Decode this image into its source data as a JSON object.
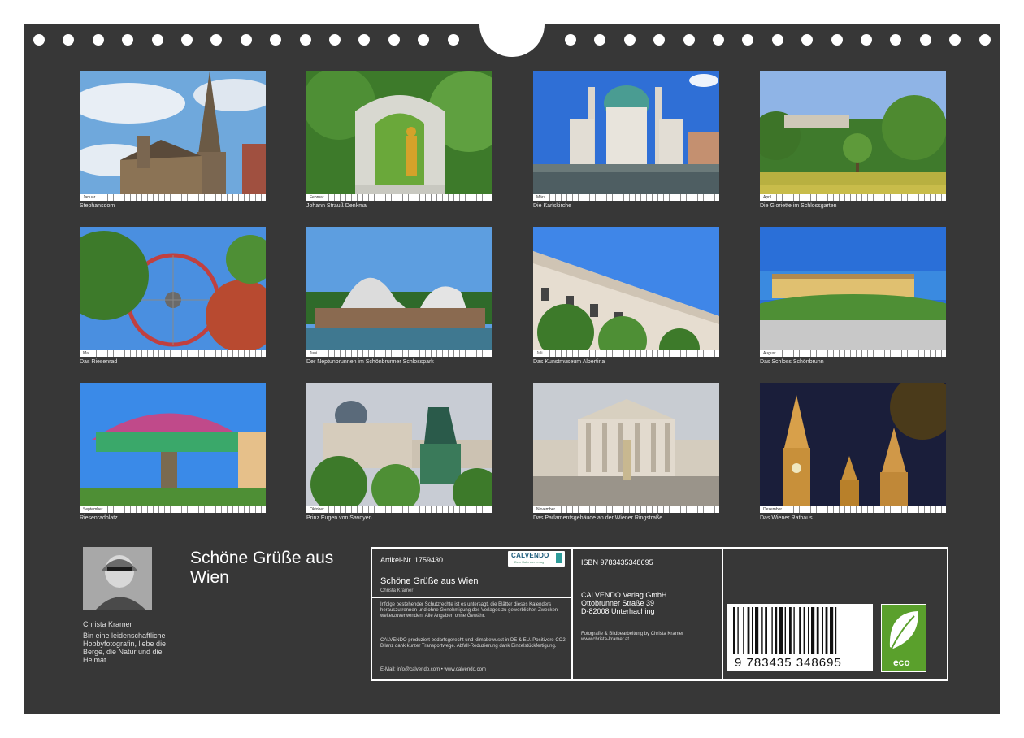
{
  "photos": [
    {
      "caption": "Stephansdom",
      "month": "Januar"
    },
    {
      "caption": "Johann Strauß Denkmal",
      "month": "Februar"
    },
    {
      "caption": "Die Karlskirche",
      "month": "März"
    },
    {
      "caption": "Die Gloriette im Schlossgarten",
      "month": "April"
    },
    {
      "caption": "Das Riesenrad",
      "month": "Mai"
    },
    {
      "caption": "Der Neptunbrunnen im Schönbrunner Schlosspark",
      "month": "Juni"
    },
    {
      "caption": "Das Kunstmuseum Albertina",
      "month": "Juli"
    },
    {
      "caption": "Das Schloss Schönbrunn",
      "month": "August"
    },
    {
      "caption": "Riesenradplatz",
      "month": "September"
    },
    {
      "caption": "Prinz Eugen von Savoyen",
      "month": "Oktober"
    },
    {
      "caption": "Das Parlamentsgebäude an der Wiener Ringstraße",
      "month": "November"
    },
    {
      "caption": "Das Wiener Rathaus",
      "month": "Dezember"
    }
  ],
  "author": {
    "name": "Christa Kramer",
    "bio": "Bin eine leidenschaftliche Hobbyfotografin, liebe die Berge, die Natur und die Heimat."
  },
  "title": "Schöne Grüße aus Wien",
  "info": {
    "article": "Artikel-Nr. 1759430",
    "logo_name": "CALVENDO",
    "logo_sub": "Dein Kalenderverlag",
    "calendar_title": "Schöne Grüße aus Wien",
    "calendar_author": "Christa Kramer",
    "legal": "Infolge bestehender Schutzrechte ist es untersagt, die Blätter dieses Kalenders herauszutrennen und ohne Genehmigung des Verlages zu gewerblichen Zwecken weiterzuverwenden. Alle Angaben ohne Gewähr.",
    "environment": "CALVENDO produziert bedarfsgerecht und klimabewusst in DE & EU. Positivere CO2-Bilanz dank kurzer Transportwege. Abfall-Reduzierung dank Einzelstückfertigung.",
    "contact": "E-Mail: info@calvendo.com • www.calvendo.com",
    "isbn": "ISBN 9783435348695",
    "publisher_name": "CALVENDO Verlag GmbH",
    "publisher_street": "Ottobrunner Straße 39",
    "publisher_city": "D-82008 Unterhaching",
    "credit": "Fotografie & Bildbearbeitung by Christa Kramer",
    "credit_url": "www.christa-kramer.at",
    "barcode_digits": "9 783435 348695",
    "eco_label": "eco"
  },
  "colors": {
    "background": "#373737",
    "text": "#ffffff",
    "eco": "#5aa02c"
  }
}
